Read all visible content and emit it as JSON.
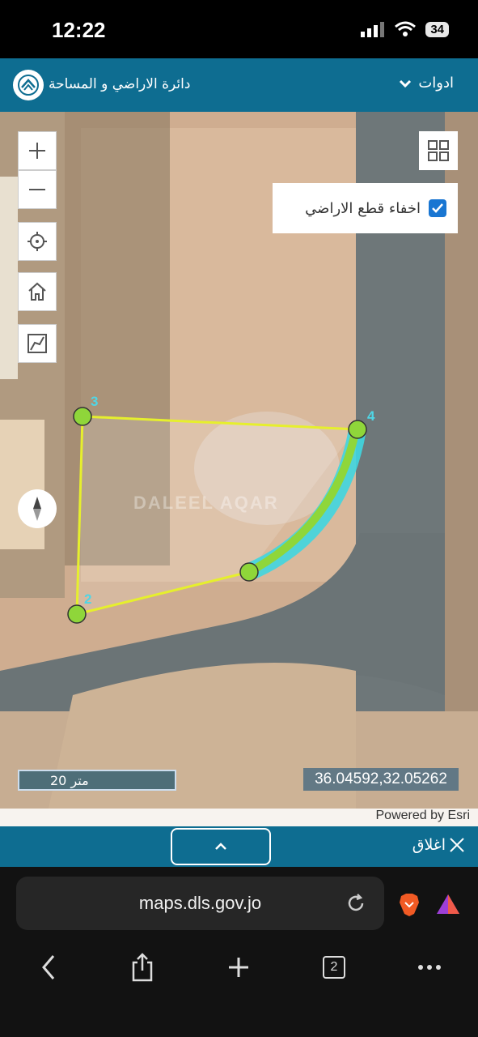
{
  "status_bar": {
    "time": "12:22",
    "battery": "34"
  },
  "header": {
    "title": "دائرة الاراضي و المساحة",
    "tools_label": "ادوات"
  },
  "map": {
    "hide_parcels_label": "اخفاء قطع الاراضي",
    "hide_parcels_checked": true,
    "scale_label": "20 متر",
    "coordinates": "36.04592,32.05262",
    "attribution": "Powered by Esri",
    "watermark": "DALEEL AQAR",
    "vertices": [
      "3",
      "2",
      "4"
    ]
  },
  "bottom_panel": {
    "close_label": "اغلاق"
  },
  "browser": {
    "url": "maps.dls.gov.jo",
    "tab_count": "2"
  },
  "colors": {
    "header": "#0e6d91",
    "parcel_line": "#e6ef2d",
    "vertex": "#8fd63a",
    "arc": "#3fd6e0"
  }
}
